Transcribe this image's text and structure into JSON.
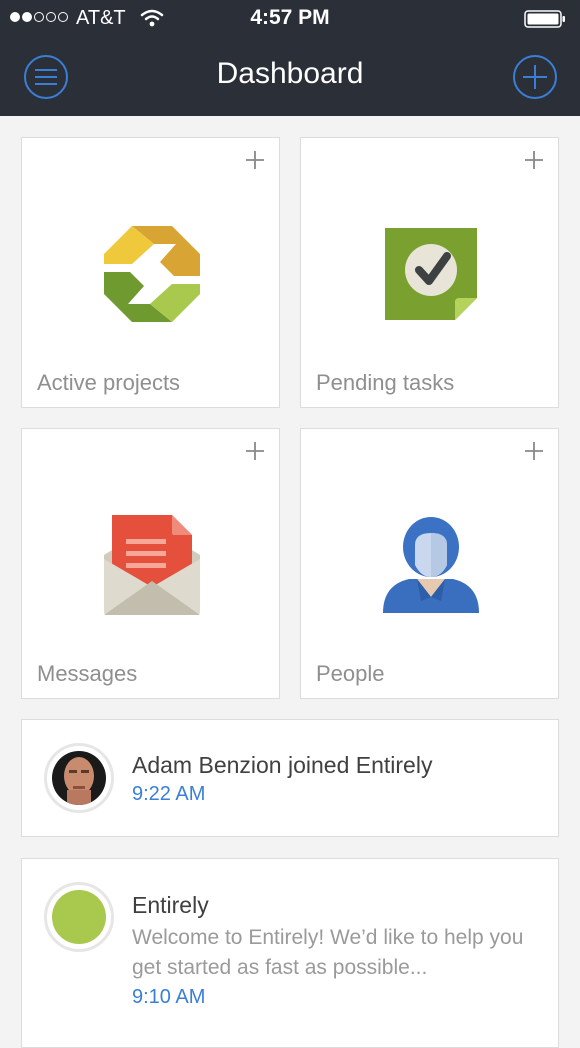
{
  "status_bar": {
    "carrier": "AT&T",
    "time": "4:57 PM"
  },
  "nav": {
    "title": "Dashboard",
    "menu_icon": "hamburger-icon",
    "add_icon": "plus-icon",
    "accent": "#3a7fd5"
  },
  "tiles": [
    {
      "label": "Active projects",
      "icon": "refresh-arrows-icon"
    },
    {
      "label": "Pending tasks",
      "icon": "checkmark-note-icon"
    },
    {
      "label": "Messages",
      "icon": "envelope-letter-icon"
    },
    {
      "label": "People",
      "icon": "person-icon"
    }
  ],
  "feed": [
    {
      "title": "Adam Benzion joined Entirely",
      "time": "9:22 AM",
      "avatar": "user-photo"
    },
    {
      "title": "Entirely",
      "message": "Welcome to Entirely! We’d like to help you get started as fast as possible...",
      "time": "9:10 AM",
      "avatar_color": "#a8c94d"
    }
  ]
}
